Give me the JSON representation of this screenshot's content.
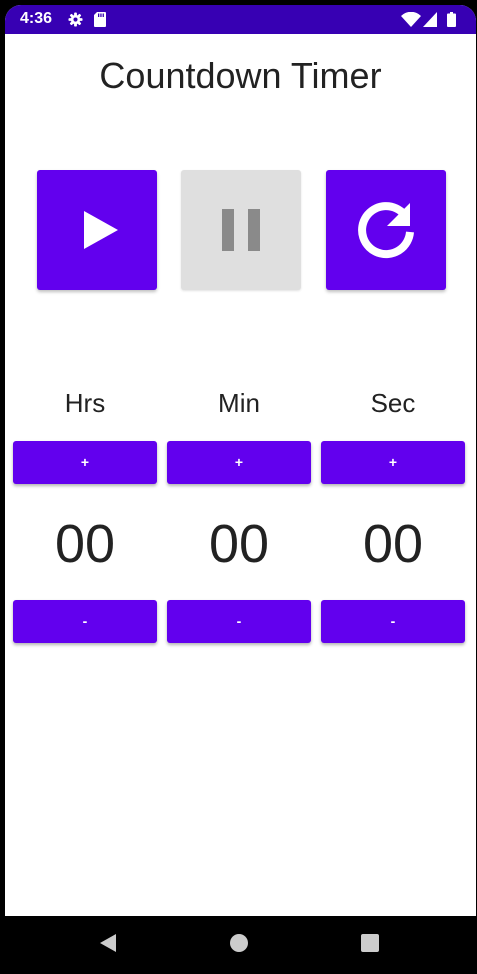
{
  "status_bar": {
    "time": "4:36",
    "icons": [
      "gear-icon",
      "sd-card-icon",
      "wifi-icon",
      "signal-icon",
      "battery-icon"
    ]
  },
  "app": {
    "title": "Countdown Timer"
  },
  "controls": [
    {
      "name": "play",
      "icon": "play-icon",
      "state": "enabled"
    },
    {
      "name": "pause",
      "icon": "pause-icon",
      "state": "disabled"
    },
    {
      "name": "reset",
      "icon": "refresh-icon",
      "state": "enabled"
    }
  ],
  "timer": {
    "columns": [
      {
        "label": "Hrs",
        "value": "00",
        "plus_label": "+",
        "minus_label": "-"
      },
      {
        "label": "Min",
        "value": "00",
        "plus_label": "+",
        "minus_label": "-"
      },
      {
        "label": "Sec",
        "value": "00",
        "plus_label": "+",
        "minus_label": "-"
      }
    ]
  },
  "nav_bar": {
    "buttons": [
      "back-icon",
      "home-icon",
      "recents-icon"
    ]
  },
  "colors": {
    "accent": "#6200ee",
    "status_bar": "#3700b3",
    "disabled": "#dfdfdf",
    "text": "#222222"
  }
}
